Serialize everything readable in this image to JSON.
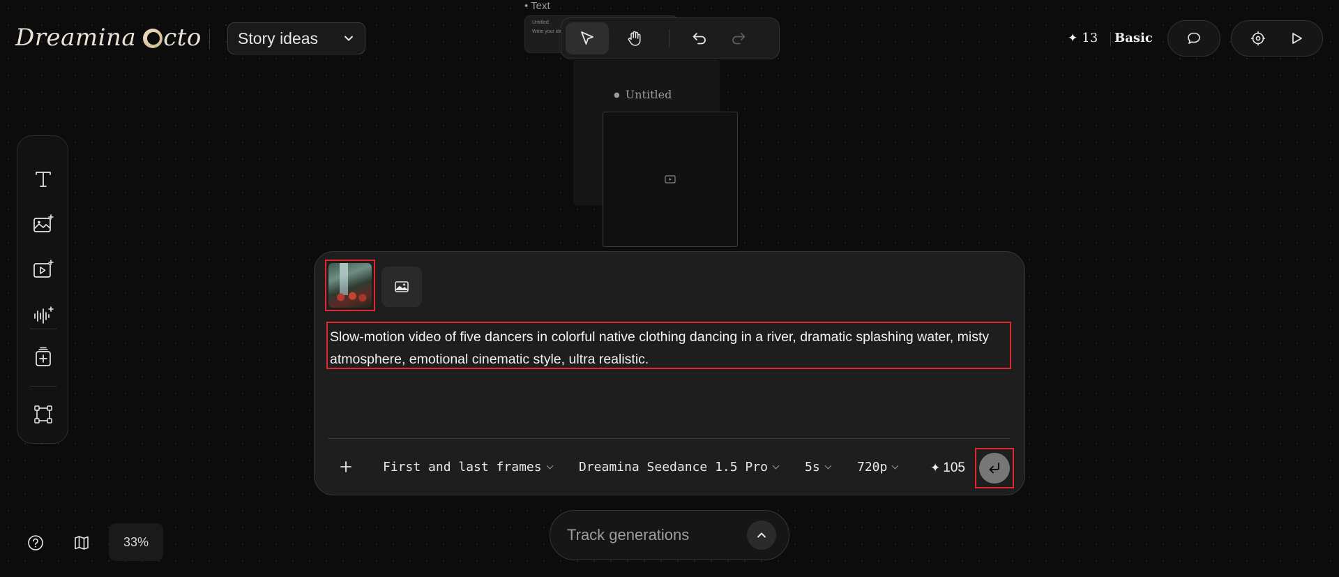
{
  "header": {
    "logo_text": "Dreamina",
    "logo_suffix": "cto",
    "project_dropdown": "Story ideas",
    "credits": "13",
    "plan": "Basic"
  },
  "canvas": {
    "bg_text_label": "• Text",
    "mini_card_title": "Untitled",
    "mini_card_body": "Write your ide",
    "node_title": "Untitled"
  },
  "prompt": {
    "text": "Slow-motion video of five dancers in colorful native clothing dancing in a river, dramatic splashing water, misty atmosphere, emotional cinematic style, ultra realistic."
  },
  "options": {
    "mode": "First and last frames",
    "model": "Dreamina Seedance 1.5 Pro",
    "duration": "5s",
    "resolution": "720p",
    "cost": "105"
  },
  "bottom": {
    "track_label": "Track generations",
    "zoom": "33%"
  },
  "colors": {
    "background": "#0c0c0c",
    "panel": "#1e1e1e",
    "highlight": "#e0282e",
    "send": "#777777"
  }
}
